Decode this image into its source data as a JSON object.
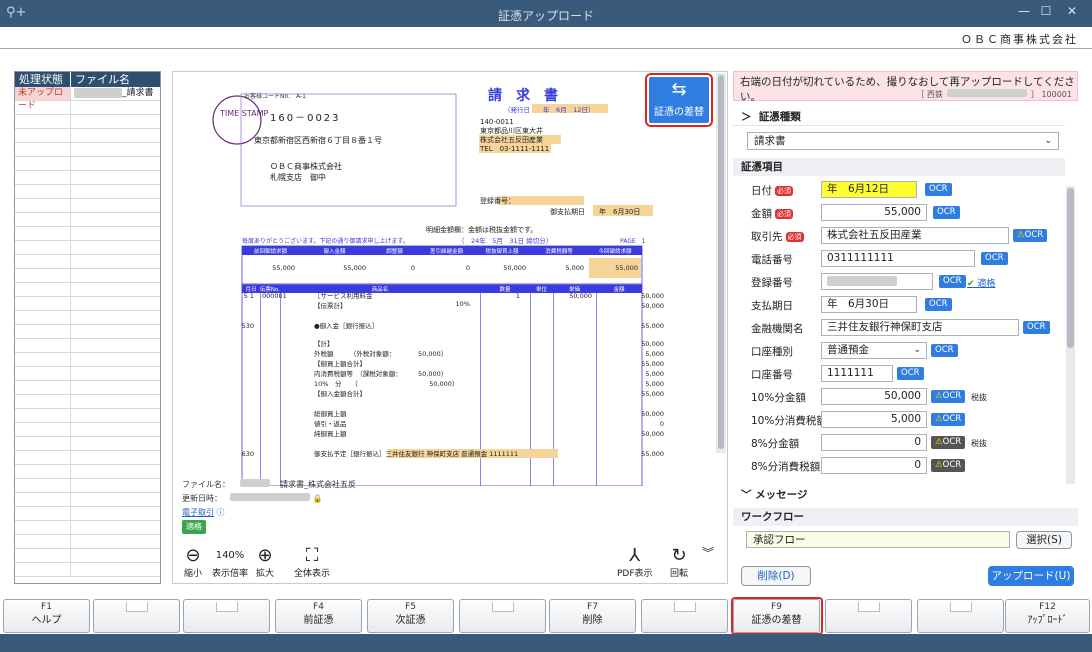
{
  "window": {
    "title": "証憑アップロード",
    "minimize": "—",
    "maximize": "☐",
    "close": "✕"
  },
  "company": "ＯＢＣ商事株式会社",
  "file_list": {
    "headers": [
      "処理状態",
      "ファイル名"
    ],
    "rows": [
      {
        "status": "未アップロード",
        "name": "_請求書"
      }
    ]
  },
  "viewer": {
    "swap_button": "証憑の差替",
    "file_info": {
      "file_label": "ファイル名：",
      "file_name": "請求書_株式会社五反",
      "updated_label": "更新日時：",
      "e_transaction": "電子取引",
      "badge": "適格"
    },
    "toolbar": {
      "zoom_out": "縮小",
      "zoom_value": "140%",
      "zoom_label": "表示倍率",
      "zoom_in": "拡大",
      "fit": "全体表示",
      "pdf": "PDF表示",
      "rotate": "回転"
    }
  },
  "document": {
    "title": "請　求　書",
    "issue_date": "（発行日　　年　6月　12日）",
    "customer_code": "お客様コードNo.　A-1",
    "postal": "160－0023",
    "address": "東京都新宿区西新宿６丁目８番１号",
    "customer": "ＯＢＣ商事株式会社",
    "customer_branch": "札幌支店　御中",
    "stamp": "TIME STAMP",
    "sender_zip": "140-0011",
    "sender_addr": "東京都品川区東大井",
    "sender_name": "株式会社五反田産業",
    "sender_tel": "TEL　03-1111-1111",
    "reg_no": "登録番号：",
    "due": "御支払期日　　年　6月30日",
    "note": "明細金額欄：金額は税抜金額です。",
    "thanks": "毎度ありがとうございます。下記の通り御請求申し上げます。",
    "closing": "（　24年　5月　31日 締切分）",
    "page": "PAGE　1",
    "summary_headers": [
      "前回御請求額",
      "御入金額",
      "調整額",
      "差引繰越金額",
      "税抜御買上額",
      "消費税額等",
      "今回御請求額"
    ],
    "summary_values": [
      "55,000",
      "55,000",
      "0",
      "0",
      "50,000",
      "5,000",
      "55,000"
    ],
    "detail_headers": [
      "月日",
      "伝票No.",
      "商品名",
      "数量",
      "単位",
      "単価",
      "金額"
    ],
    "lines": [
      {
        "d": "5 1",
        "no": "000001",
        "name": "［サービス利用料金",
        "rate": "10%",
        "qty": "1",
        "price": "50,000",
        "amt": "50,000"
      },
      {
        "name": "【伝票計】",
        "amt": "50,000"
      },
      {
        "d": "530",
        "name": "●御入金［銀行振込］",
        "amt": "55,000"
      },
      {
        "name": "【計】",
        "amt": "50,000"
      },
      {
        "name": "外税額　　　（外税対象額：　　　　50,000）",
        "amt": "5,000"
      },
      {
        "name": "【御買上額合計】",
        "amt": "55,000"
      },
      {
        "name": "内消費税額等　（課税対象額：　　　50,000）",
        "amt": "5,000"
      },
      {
        "name": "10%　分　　（　　　　　　　　　　　50,000）",
        "amt": "5,000"
      },
      {
        "name": "【御入金額合計】",
        "amt": "55,000"
      },
      {
        "name": "総御買上額",
        "amt": "50,000"
      },
      {
        "name": "値引・返品",
        "amt": "0"
      },
      {
        "name": "純御買上額",
        "amt": "50,000"
      },
      {
        "d": "630",
        "name": "御支払予定［銀行振込］三井住友銀行 神保町支店 普通預金 1111111",
        "amt": "55,000"
      }
    ]
  },
  "alert": {
    "message": "右端の日付が切れているため、撮りなおして再アップロードしてください。",
    "sub": "［ 西鉄",
    "code": "］ 100001"
  },
  "right_panel": {
    "type_section": "証憑種類",
    "type_value": "請求書",
    "items_section": "証憑項目",
    "required": "必須",
    "ocr": "OCR",
    "fields": [
      {
        "label": "日付",
        "value": "年　6月12日"
      },
      {
        "label": "金額",
        "value": "55,000"
      },
      {
        "label": "取引先",
        "value": "株式会社五反田産業"
      },
      {
        "label": "電話番号",
        "value": "0311111111"
      },
      {
        "label": "登録番号",
        "value": "",
        "status": "適格"
      },
      {
        "label": "支払期日",
        "value": "年　6月30日"
      },
      {
        "label": "金融機関名",
        "value": "三井住友銀行神保町支店"
      },
      {
        "label": "口座種別",
        "value": "普通預金"
      },
      {
        "label": "口座番号",
        "value": "1111111"
      },
      {
        "label": "10%分金額",
        "value": "50,000",
        "tax": "税抜"
      },
      {
        "label": "10%分消費税額",
        "value": "5,000"
      },
      {
        "label": "8%分金額",
        "value": "0",
        "tax": "税抜"
      },
      {
        "label": "8%分消費税額",
        "value": "0"
      }
    ],
    "message_section": "メッセージ",
    "workflow_section": "ワークフロー",
    "workflow_value": "承認フロー",
    "select_button": "選択(S)",
    "delete_button": "削除(D)",
    "upload_button": "アップロード(U)"
  },
  "function_keys": [
    {
      "key": "F1",
      "label": "ヘルプ"
    },
    {
      "key": "",
      "label": ""
    },
    {
      "key": "",
      "label": ""
    },
    {
      "key": "F4",
      "label": "前証憑"
    },
    {
      "key": "F5",
      "label": "次証憑"
    },
    {
      "key": "",
      "label": ""
    },
    {
      "key": "F7",
      "label": "削除"
    },
    {
      "key": "",
      "label": ""
    },
    {
      "key": "F9",
      "label": "証憑の差替"
    },
    {
      "key": "",
      "label": ""
    },
    {
      "key": "",
      "label": ""
    },
    {
      "key": "F12",
      "label": "ｱｯﾌﾟﾛｰﾄﾞ"
    }
  ],
  "colors": {
    "titlebar": "#3a5a7c",
    "accent": "#2f7de1",
    "highlight_red": "#e02424",
    "doc_blue": "#3a3adf"
  }
}
